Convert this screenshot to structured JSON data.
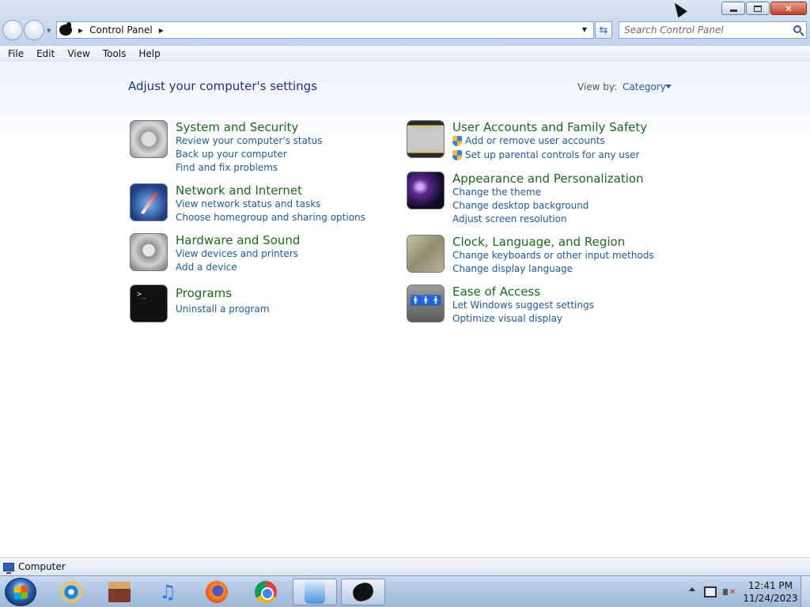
{
  "window": {
    "breadcrumb": [
      "Control Panel"
    ],
    "search_placeholder": "Search Control Panel"
  },
  "menu": [
    "File",
    "Edit",
    "View",
    "Tools",
    "Help"
  ],
  "content": {
    "heading": "Adjust your computer's settings",
    "view_by_label": "View by:",
    "view_by_value": "Category",
    "categories": [
      {
        "title": "System and Security",
        "icon": "vault-icon",
        "links": [
          "Review your computer's status",
          "Back up your computer",
          "Find and fix problems"
        ]
      },
      {
        "title": "Network and Internet",
        "icon": "compass-icon",
        "links": [
          "View network status and tasks",
          "Choose homegroup and sharing options"
        ]
      },
      {
        "title": "Hardware and Sound",
        "icon": "dvd-drive-icon",
        "links": [
          "View devices and printers",
          "Add a device"
        ]
      },
      {
        "title": "Programs",
        "icon": "terminal-icon",
        "links": [
          "Uninstall a program"
        ]
      },
      {
        "title": "User Accounts and Family Safety",
        "icon": "access-card-icon",
        "links": [
          "Add or remove user accounts",
          "Set up parental controls for any user"
        ]
      },
      {
        "title": "Appearance and Personalization",
        "icon": "galaxy-wallpaper-icon",
        "links": [
          "Change the theme",
          "Change desktop background",
          "Adjust screen resolution"
        ]
      },
      {
        "title": "Clock, Language, and Region",
        "icon": "world-map-icon",
        "links": [
          "Change keyboards or other input methods",
          "Change display language"
        ]
      },
      {
        "title": "Ease of Access",
        "icon": "people-icon",
        "links": [
          "Let Windows suggest settings",
          "Optimize visual display"
        ]
      }
    ]
  },
  "status_bar": {
    "label": "Computer"
  },
  "taskbar": {
    "apps": [
      "internet-explorer-icon",
      "store-icon",
      "itunes-icon",
      "firefox-icon",
      "chrome-icon",
      "robot-app-icon",
      "control-panel-icon"
    ],
    "time": "12:41 PM",
    "date": "11/24/2023"
  }
}
